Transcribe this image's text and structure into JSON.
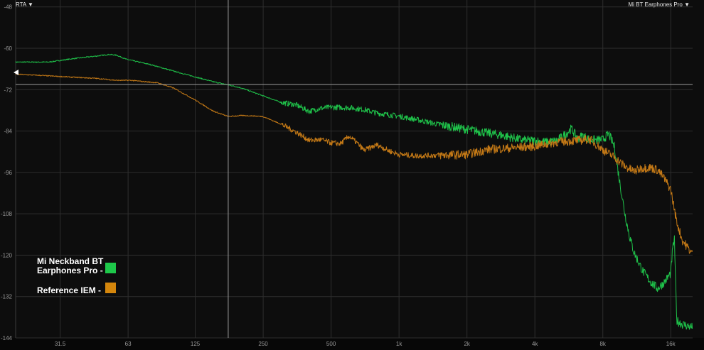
{
  "header": {
    "mode_label": "RTA ▼",
    "device_label": "Mi BT Earphones Pro ▼"
  },
  "legend": {
    "item1_line1": "Mi Neckband BT",
    "item1_line2": "Earphones Pro -",
    "item2": "Reference IEM -"
  },
  "colors": {
    "background": "#0d0d0d",
    "grid": "#2e2e2e",
    "series_green": "#1fc24a",
    "series_orange": "#c27816",
    "swatch_green": "#1ec84a",
    "swatch_orange": "#d4860c",
    "cursor": "#9a9a9a"
  },
  "chart_data": {
    "type": "line",
    "title": "",
    "xlabel": "",
    "ylabel": "",
    "x_scale": "log",
    "xlim": [
      20,
      20000
    ],
    "ylim": [
      -144,
      -46
    ],
    "x_ticks": [
      31.5,
      63,
      125,
      250,
      500,
      1000,
      2000,
      4000,
      8000,
      16000
    ],
    "x_tick_labels": [
      "31.5",
      "63",
      "125",
      "250",
      "500",
      "1k",
      "2k",
      "4k",
      "8k",
      "16k"
    ],
    "y_ticks": [
      -48,
      -60,
      -72,
      -84,
      -96,
      -108,
      -120,
      -132,
      -144
    ],
    "y_tick_labels": [
      "-48",
      "-60",
      "-72",
      "-84",
      "-96",
      "-108",
      "-120",
      "-132",
      "-144"
    ],
    "grid": true,
    "cursor": {
      "x": 175,
      "y": -70.5
    },
    "reference_marker_y": -67,
    "legend_position": "bottom-left",
    "series": [
      {
        "name": "Mi Neckband BT Earphones Pro",
        "color": "#1fc24a",
        "x": [
          20,
          28,
          36,
          45,
          52,
          56,
          62,
          80,
          100,
          125,
          150,
          175,
          200,
          250,
          300,
          350,
          400,
          450,
          500,
          600,
          700,
          800,
          1000,
          1200,
          1500,
          2000,
          2500,
          3000,
          3500,
          4000,
          4500,
          5000,
          5500,
          5800,
          6200,
          6500,
          7000,
          7500,
          8000,
          8500,
          9000,
          9500,
          10000,
          10500,
          11000,
          12000,
          13000,
          14000,
          15000,
          16000,
          16300,
          16600,
          17000,
          18000,
          20000
        ],
        "y": [
          -64,
          -64,
          -63,
          -62.3,
          -61.8,
          -62,
          -63.2,
          -64.8,
          -66.6,
          -68.3,
          -69.7,
          -70.6,
          -71.5,
          -73.8,
          -75.7,
          -76.4,
          -78.3,
          -77.4,
          -77.1,
          -77.2,
          -77.8,
          -78.8,
          -79.7,
          -80.7,
          -82.1,
          -83.5,
          -84.6,
          -85.5,
          -86.6,
          -86.8,
          -87.2,
          -86.8,
          -84.8,
          -83.3,
          -86.2,
          -85.3,
          -86.5,
          -86.6,
          -86.5,
          -84.8,
          -88.5,
          -98.7,
          -107.6,
          -114.5,
          -119.2,
          -124.5,
          -127.7,
          -129.7,
          -127.8,
          -125.2,
          -118.5,
          -115,
          -139,
          -140,
          -141
        ]
      },
      {
        "name": "Reference IEM",
        "color": "#c27816",
        "x": [
          20,
          28,
          36,
          45,
          50,
          56,
          65,
          75,
          85,
          100,
          125,
          150,
          175,
          200,
          225,
          250,
          300,
          350,
          400,
          450,
          500,
          550,
          600,
          650,
          700,
          800,
          900,
          1000,
          1200,
          1500,
          2000,
          2500,
          3000,
          4000,
          5000,
          6000,
          7000,
          8000,
          9000,
          10000,
          11000,
          12000,
          13000,
          14000,
          15000,
          16000,
          17000,
          18000,
          20000
        ],
        "y": [
          -67.5,
          -68,
          -68.4,
          -68.7,
          -69,
          -69.3,
          -69.3,
          -69.7,
          -70,
          -71.5,
          -75,
          -78.2,
          -79.8,
          -79.5,
          -79.6,
          -79.8,
          -82,
          -84.3,
          -86.7,
          -86.5,
          -87.4,
          -87.7,
          -85.5,
          -87.4,
          -89.6,
          -88,
          -89.7,
          -90.8,
          -91.2,
          -91,
          -90.8,
          -89.3,
          -89,
          -88.4,
          -87.2,
          -86.8,
          -86.4,
          -89.4,
          -91.6,
          -94.2,
          -95.7,
          -94.7,
          -94.6,
          -95.3,
          -97.8,
          -101,
          -110.3,
          -115.7,
          -119.7
        ]
      }
    ]
  }
}
